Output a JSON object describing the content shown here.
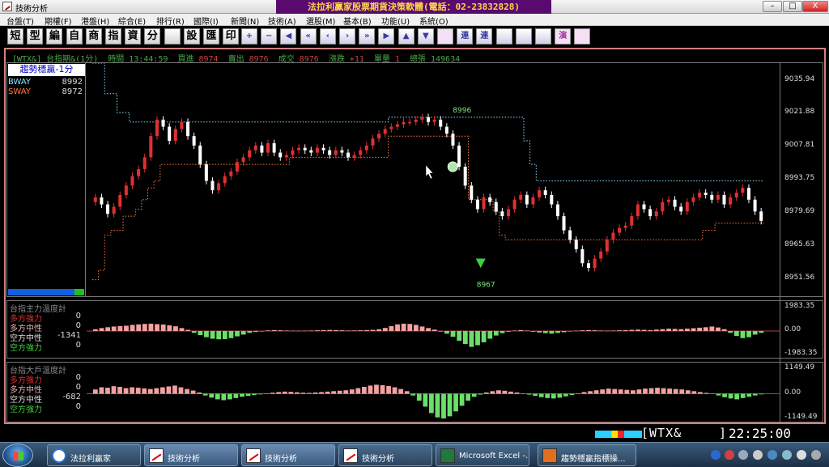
{
  "window": {
    "title": "技術分析"
  },
  "banner": "法拉利贏家股票期貨決策軟體(電話：02-23832828)",
  "window_controls": {
    "minimize": "–",
    "maximize": "□",
    "close": "X"
  },
  "menu": [
    "台盤(T)",
    "期權(F)",
    "港盤(H)",
    "綜合(E)",
    "排行(R)",
    "國際(I)",
    "新聞(N)",
    "技術(A)",
    "選股(M)",
    "基本(B)",
    "功能(U)",
    "系統(O)"
  ],
  "toolbar": {
    "text_buttons": [
      "短",
      "型",
      "編",
      "自",
      "商",
      "指",
      "資",
      "分",
      "",
      "設",
      "匯",
      "印"
    ],
    "nav_buttons": [
      "+",
      "−",
      "◀",
      "«",
      "‹",
      "›",
      "»",
      "▶",
      "▲",
      "▼",
      "",
      "連",
      "連",
      "",
      "",
      "",
      "演",
      ""
    ]
  },
  "quote_header": {
    "symbol_name": "[WTX&] 台指期&(1分)",
    "time_label": "時間",
    "time_value": "13:44:59",
    "bid_label": "買進",
    "bid_value": "8974",
    "ask_label": "賣出",
    "ask_value": "8976",
    "last_label": "成交",
    "last_value": "8976",
    "change_label": "漲跌",
    "change_value": "+11",
    "volume_label": "單量",
    "volume_value": "1",
    "total_label": "總張",
    "total_value": "149634"
  },
  "indicator": {
    "title": "趨勢穩贏-1分",
    "bway_label": "BWAY",
    "bway_value": "8992",
    "sway_label": "SWAY",
    "sway_value": "8972"
  },
  "annotations": {
    "high": "8996",
    "low": "8967"
  },
  "price_axis": [
    "9035.94",
    "9021.88",
    "9007.81",
    "8993.75",
    "8979.69",
    "8965.63",
    "8951.56"
  ],
  "panel1": {
    "title": "台指主力溫度計",
    "rows": [
      {
        "label": "多方強力",
        "value": "0"
      },
      {
        "label": "多方中性",
        "value": "0"
      },
      {
        "label": "空方中性",
        "value": "-1341"
      },
      {
        "label": "空方強力",
        "value": "0"
      }
    ],
    "axis": [
      "1983.35",
      "0.00",
      "-1983.35"
    ]
  },
  "panel2": {
    "title": "台指大戶溫度計",
    "rows": [
      {
        "label": "多方強力",
        "value": "0"
      },
      {
        "label": "多方中性",
        "value": "0"
      },
      {
        "label": "空方中性",
        "value": "-682"
      },
      {
        "label": "空方強力",
        "value": "0"
      }
    ],
    "axis": [
      "1149.49",
      "0.00",
      "-1149.49"
    ]
  },
  "status": {
    "symbol": "[WTX&",
    "bracket": "]",
    "clock": "22:25:00"
  },
  "taskbar": {
    "items": [
      "法拉利贏家",
      "技術分析",
      "技術分析",
      "技術分析",
      "Microsoft Excel -...",
      "趨勢穩贏指標操..."
    ]
  },
  "colors": {
    "up_candle": "#e03030",
    "down_candle": "#ffffff",
    "bway_line": "#8fe0ff",
    "sway_line": "#ff7a3a",
    "bull_bar": "#f4a0a0",
    "bear_bar": "#6ae06a",
    "panel_border": "#d08080"
  },
  "chart_data": [
    {
      "type": "candlestick",
      "title": "[WTX&] 台指期&(1分)",
      "ylim": [
        8944,
        9043
      ],
      "yticks": [
        9035.94,
        9021.88,
        9007.81,
        8993.75,
        8979.69,
        8965.63,
        8951.56
      ],
      "close": [
        8986,
        8983,
        8979,
        8982,
        8987,
        8991,
        8995,
        8998,
        9003,
        9012,
        9019,
        9016,
        9010,
        9015,
        9018,
        9012,
        9008,
        9000,
        8993,
        8989,
        8992,
        8995,
        8997,
        9001,
        9003,
        9006,
        9008,
        9005,
        9009,
        9005,
        9003,
        9004,
        9006,
        9007,
        9006,
        9005,
        9007,
        9006,
        9004,
        9006,
        9005,
        9003,
        9004,
        9006,
        9008,
        9011,
        9013,
        9015,
        9016,
        9017,
        9018,
        9018,
        9019,
        9020,
        9018,
        9019,
        9016,
        9013,
        9008,
        8999,
        8991,
        8985,
        8981,
        8986,
        8984,
        8980,
        8978,
        8981,
        8985,
        8987,
        8983,
        8986,
        8989,
        8987,
        8983,
        8978,
        8972,
        8968,
        8964,
        8958,
        8956,
        8960,
        8963,
        8968,
        8971,
        8973,
        8974,
        8978,
        8983,
        8981,
        8978,
        8980,
        8984,
        8985,
        8982,
        8980,
        8984,
        8986,
        8988,
        8987,
        8985,
        8987,
        8983,
        8986,
        8988,
        8990,
        8985,
        8980,
        8976
      ],
      "bway": [
        9043,
        9043,
        9030,
        9030,
        9022,
        9022,
        9018,
        9018,
        9018,
        9018,
        9018,
        9018,
        9018,
        9018,
        9018,
        9018,
        9018,
        9018,
        9018,
        9018,
        9018,
        9018,
        9018,
        9018,
        9018,
        9018,
        9018,
        9018,
        9018,
        9018,
        9018,
        9018,
        9018,
        9018,
        9018,
        9018,
        9018,
        9018,
        9018,
        9018,
        9018,
        9018,
        9018,
        9018,
        9018,
        9018,
        9018,
        9018,
        9020,
        9020,
        9020,
        9020,
        9020,
        9020,
        9020,
        9020,
        9020,
        9020,
        9020,
        9020,
        9020,
        9020,
        9020,
        9020,
        9020,
        9020,
        9020,
        9020,
        9020,
        9020,
        9010,
        9000,
        8993,
        8993,
        8993,
        8993,
        8993,
        8993,
        8993,
        8993,
        8993,
        8993,
        8993,
        8993,
        8993,
        8993,
        8993,
        8993,
        8993,
        8993,
        8993,
        8993,
        8993,
        8993,
        8993,
        8993,
        8993,
        8993,
        8993,
        8993,
        8993,
        8993,
        8993,
        8993,
        8993,
        8993,
        8993,
        8993,
        8993
      ],
      "sway": [
        8951,
        8955,
        8970,
        8972,
        8972,
        8978,
        8978,
        8981,
        8985,
        8990,
        8993,
        9000,
        9000,
        9000,
        9000,
        9000,
        9000,
        9000,
        9000,
        9000,
        9000,
        9000,
        9000,
        9000,
        9000,
        9000,
        9000,
        9000,
        9000,
        9000,
        9000,
        9000,
        9003,
        9003,
        9003,
        9003,
        9003,
        9003,
        9003,
        9003,
        9003,
        9003,
        9003,
        9003,
        9003,
        9003,
        9003,
        9003,
        9012,
        9012,
        9012,
        9012,
        9012,
        9012,
        9012,
        9012,
        9012,
        9012,
        9012,
        9012,
        9012,
        8985,
        8985,
        8985,
        8985,
        8980,
        8970,
        8968,
        8968,
        8968,
        8968,
        8968,
        8968,
        8968,
        8968,
        8968,
        8968,
        8968,
        8968,
        8968,
        8968,
        8968,
        8968,
        8968,
        8968,
        8968,
        8968,
        8968,
        8968,
        8968,
        8968,
        8968,
        8968,
        8968,
        8968,
        8968,
        8968,
        8968,
        8968,
        8972,
        8972,
        8975,
        8975,
        8975,
        8975,
        8975,
        8975,
        8975,
        8975
      ]
    },
    {
      "type": "bar",
      "title": "台指主力溫度計",
      "ylim": [
        -1983.35,
        1983.35
      ],
      "values": [
        150,
        250,
        320,
        380,
        420,
        450,
        520,
        560,
        600,
        620,
        580,
        550,
        480,
        400,
        250,
        100,
        -150,
        -350,
        -520,
        -650,
        -700,
        -680,
        -600,
        -450,
        -300,
        -150,
        -80,
        -40,
        50,
        80,
        60,
        40,
        30,
        20,
        30,
        40,
        60,
        80,
        90,
        80,
        60,
        40,
        50,
        60,
        80,
        100,
        150,
        260,
        420,
        560,
        620,
        600,
        520,
        380,
        250,
        120,
        -50,
        -220,
        -480,
        -820,
        -1100,
        -1341,
        -1200,
        -950,
        -650,
        -380,
        -180,
        -60,
        40,
        80,
        40,
        -60,
        -120,
        -180,
        -220,
        -160,
        -100,
        -40,
        30,
        60,
        80,
        60,
        40,
        30,
        40,
        60,
        80,
        100,
        120,
        100,
        80,
        120,
        160,
        200,
        180,
        160,
        200,
        240,
        280,
        320,
        380,
        300,
        160,
        -150,
        -420,
        -600,
        -520,
        -300,
        -150
      ]
    },
    {
      "type": "bar",
      "title": "台指大戶溫度計",
      "ylim": [
        -1149.49,
        1149.49
      ],
      "values": [
        200,
        300,
        280,
        350,
        320,
        260,
        300,
        280,
        250,
        220,
        260,
        300,
        340,
        380,
        300,
        220,
        150,
        60,
        -80,
        -180,
        -260,
        -300,
        -260,
        -200,
        -140,
        -100,
        -60,
        -30,
        20,
        50,
        80,
        100,
        90,
        70,
        50,
        40,
        60,
        80,
        100,
        120,
        140,
        160,
        200,
        260,
        320,
        380,
        420,
        400,
        360,
        300,
        220,
        120,
        -80,
        -320,
        -600,
        -900,
        -1100,
        -1149,
        -1050,
        -820,
        -560,
        -320,
        -140,
        -40,
        60,
        120,
        160,
        140,
        100,
        60,
        20,
        -40,
        -100,
        -160,
        -200,
        -220,
        -180,
        -120,
        -60,
        20,
        80,
        120,
        160,
        200,
        240,
        220,
        200,
        180,
        160,
        200,
        240,
        260,
        280,
        260,
        240,
        220,
        200,
        160,
        120,
        80,
        40,
        0,
        -80,
        -160,
        -220,
        -260,
        -200,
        -140,
        -80,
        -30
      ]
    }
  ]
}
